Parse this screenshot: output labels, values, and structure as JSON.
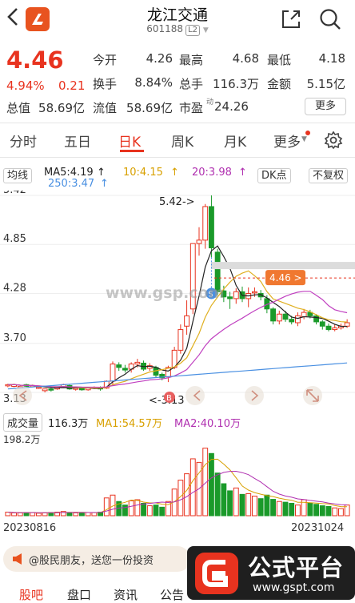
{
  "header": {
    "title": "龙江交通",
    "code": "601188",
    "level": "L2",
    "icons": [
      "back-icon",
      "app-logo-icon",
      "share-icon",
      "search-icon"
    ]
  },
  "quote": {
    "price": "4.46",
    "change_pct": "4.94%",
    "change": "0.21",
    "open_label": "今开",
    "open": "4.26",
    "high_label": "最高",
    "high": "4.68",
    "low_label": "最低",
    "low": "4.18",
    "turnover_label": "换手",
    "turnover": "8.84%",
    "volume_label": "总手",
    "volume": "116.3万",
    "amount_label": "金额",
    "amount": "5.15亿",
    "mktcap_label": "总值",
    "mktcap": "58.69亿",
    "float_label": "流值",
    "float": "58.69亿",
    "pe_label": "市盈",
    "pe_sup": "动",
    "pe": "24.26",
    "more": "更多"
  },
  "tabs": [
    {
      "label": "分时"
    },
    {
      "label": "五日"
    },
    {
      "label": "日K"
    },
    {
      "label": "周K"
    },
    {
      "label": "月K"
    },
    {
      "label": "更多"
    }
  ],
  "ma_bar": {
    "select": "均线",
    "ma5": "MA5:4.19",
    "ma10": "10:4.15",
    "ma20": "20:3.98",
    "ma250": "250:3.47",
    "dk": "DK点",
    "fq": "不复权"
  },
  "colors": {
    "up": "#e8331f",
    "down": "#1a9a2a",
    "ma5": "#222222",
    "ma10": "#e0b020",
    "ma20": "#c040c0",
    "ma250": "#4a90e2"
  },
  "kchart": {
    "y_ticks": [
      "5.42",
      "4.85",
      "4.28",
      "3.70",
      "3.13"
    ],
    "max_label": "5.42->",
    "min_label": "<-3.13",
    "price_tag": "4.46 >",
    "b_marker": "B",
    "s_marker": "S"
  },
  "volume": {
    "select": "成交量",
    "vol": "116.3万",
    "ma1": "MA1:54.57万",
    "ma2": "MA2:40.10万",
    "max": "198.2万"
  },
  "dates": {
    "start": "20230816",
    "end": "20231024"
  },
  "promo": {
    "text": "@股民朋友，送您一份投资"
  },
  "bottom_tabs": [
    "股吧",
    "盘口",
    "资讯",
    "公告"
  ],
  "watermark": {
    "big": "公式平台",
    "small": "www.gspt.com",
    "mid": "www.gsp.com"
  },
  "chart_data": {
    "type": "candlestick",
    "x": [
      "20230816",
      "20231024"
    ],
    "ylim": [
      3.13,
      5.42
    ],
    "candles": [
      [
        3.21,
        3.22,
        3.23,
        3.19
      ],
      [
        3.2,
        3.22,
        3.23,
        3.19
      ],
      [
        3.19,
        3.2,
        3.21,
        3.18
      ],
      [
        3.22,
        3.2,
        3.23,
        3.19
      ],
      [
        3.21,
        3.21,
        3.22,
        3.2
      ],
      [
        3.18,
        3.19,
        3.2,
        3.17
      ],
      [
        3.15,
        3.17,
        3.17,
        3.13
      ],
      [
        3.17,
        3.16,
        3.18,
        3.14
      ],
      [
        3.17,
        3.19,
        3.2,
        3.16
      ],
      [
        3.19,
        3.22,
        3.23,
        3.18
      ],
      [
        3.21,
        3.17,
        3.22,
        3.16
      ],
      [
        3.17,
        3.18,
        3.19,
        3.15
      ],
      [
        3.18,
        3.16,
        3.19,
        3.15
      ],
      [
        3.16,
        3.18,
        3.19,
        3.15
      ],
      [
        3.18,
        3.19,
        3.2,
        3.17
      ],
      [
        3.19,
        3.17,
        3.2,
        3.15
      ],
      [
        3.18,
        3.26,
        3.27,
        3.17
      ],
      [
        3.26,
        3.46,
        3.49,
        3.22
      ],
      [
        3.45,
        3.42,
        3.48,
        3.38
      ],
      [
        3.41,
        3.39,
        3.45,
        3.36
      ],
      [
        3.4,
        3.46,
        3.48,
        3.36
      ],
      [
        3.46,
        3.48,
        3.52,
        3.42
      ],
      [
        3.47,
        3.4,
        3.5,
        3.38
      ],
      [
        3.41,
        3.44,
        3.47,
        3.38
      ],
      [
        3.42,
        3.33,
        3.44,
        3.3
      ],
      [
        3.34,
        3.3,
        3.36,
        3.27
      ],
      [
        3.31,
        3.42,
        3.44,
        3.25
      ],
      [
        3.42,
        3.62,
        3.66,
        3.4
      ],
      [
        3.62,
        3.86,
        3.92,
        3.58
      ],
      [
        3.9,
        4.02,
        4.2,
        3.8
      ],
      [
        4.1,
        4.86,
        4.86,
        4.04
      ],
      [
        4.86,
        4.9,
        5.05,
        4.72
      ],
      [
        4.9,
        5.29,
        5.32,
        4.8
      ],
      [
        5.29,
        4.81,
        5.42,
        4.7
      ],
      [
        4.76,
        4.3,
        4.8,
        4.26
      ],
      [
        4.31,
        4.24,
        4.37,
        4.18
      ],
      [
        4.24,
        4.22,
        4.3,
        4.1
      ],
      [
        4.22,
        4.3,
        4.34,
        4.16
      ],
      [
        4.3,
        4.22,
        4.36,
        4.18
      ],
      [
        4.22,
        4.28,
        4.35,
        4.12
      ],
      [
        4.29,
        4.3,
        4.35,
        4.24
      ],
      [
        4.28,
        4.24,
        4.32,
        4.2
      ],
      [
        4.22,
        4.1,
        4.26,
        4.05
      ],
      [
        4.1,
        3.96,
        4.12,
        3.92
      ],
      [
        3.96,
        4.04,
        4.08,
        3.92
      ],
      [
        4.04,
        3.98,
        4.08,
        3.95
      ],
      [
        3.98,
        3.95,
        4.02,
        3.92
      ],
      [
        3.94,
        4.02,
        4.06,
        3.9
      ],
      [
        4.01,
        4.06,
        4.1,
        3.98
      ],
      [
        4.06,
        4.02,
        4.09,
        3.99
      ],
      [
        4.02,
        3.95,
        4.04,
        3.92
      ],
      [
        3.95,
        3.9,
        3.97,
        3.86
      ],
      [
        3.9,
        3.86,
        3.93,
        3.84
      ],
      [
        3.86,
        3.88,
        3.92,
        3.84
      ],
      [
        3.88,
        3.9,
        3.93,
        3.86
      ],
      [
        3.9,
        3.94,
        3.98,
        3.88
      ]
    ],
    "volumes": [
      10,
      8,
      8,
      9,
      9,
      7,
      8,
      9,
      10,
      12,
      9,
      8,
      8,
      9,
      9,
      10,
      50,
      58,
      40,
      30,
      42,
      45,
      35,
      28,
      30,
      24,
      40,
      75,
      100,
      118,
      160,
      150,
      190,
      175,
      120,
      90,
      70,
      78,
      60,
      62,
      55,
      48,
      58,
      46,
      40,
      38,
      35,
      30,
      45,
      35,
      32,
      28,
      26,
      22,
      20,
      30
    ]
  }
}
